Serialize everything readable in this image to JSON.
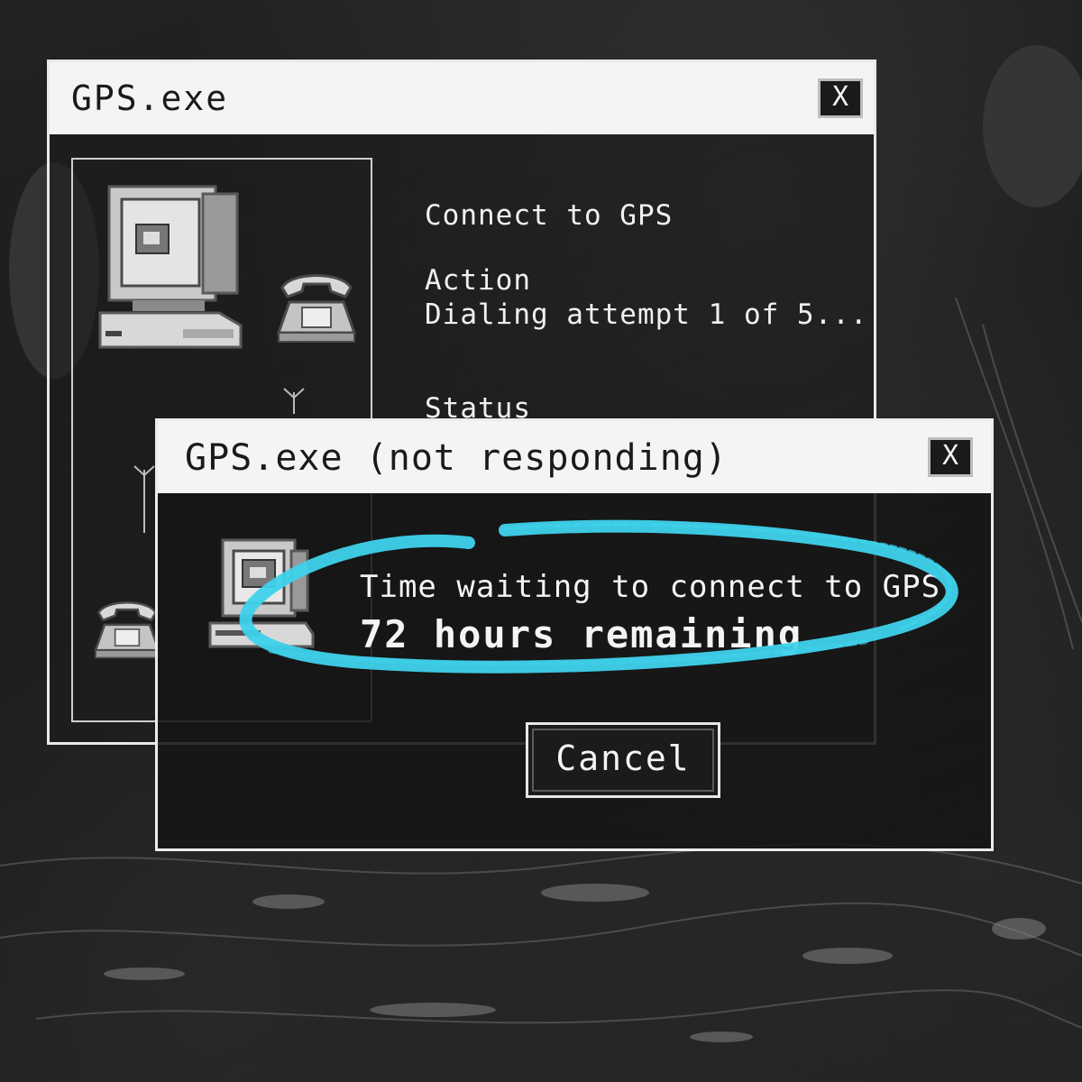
{
  "back_window": {
    "title": "GPS.exe",
    "close_label": "X",
    "heading": "Connect to GPS",
    "action_label": "Action",
    "action_value": "Dialing attempt 1 of 5...",
    "status_label": "Status"
  },
  "front_window": {
    "title": "GPS.exe (not responding)",
    "close_label": "X",
    "message": "Time waiting to connect to GPS",
    "remaining": "72 hours remaining",
    "cancel_label": "Cancel"
  },
  "icons": [
    "computer-icon",
    "telephone-icon",
    "antenna-icon",
    "computer-small-icon",
    "telephone-small-icon"
  ],
  "colors": {
    "titlebar": "#f4f4f4",
    "window_bg": "#1a1a1a",
    "highlight_scribble": "#3fd2ec"
  }
}
